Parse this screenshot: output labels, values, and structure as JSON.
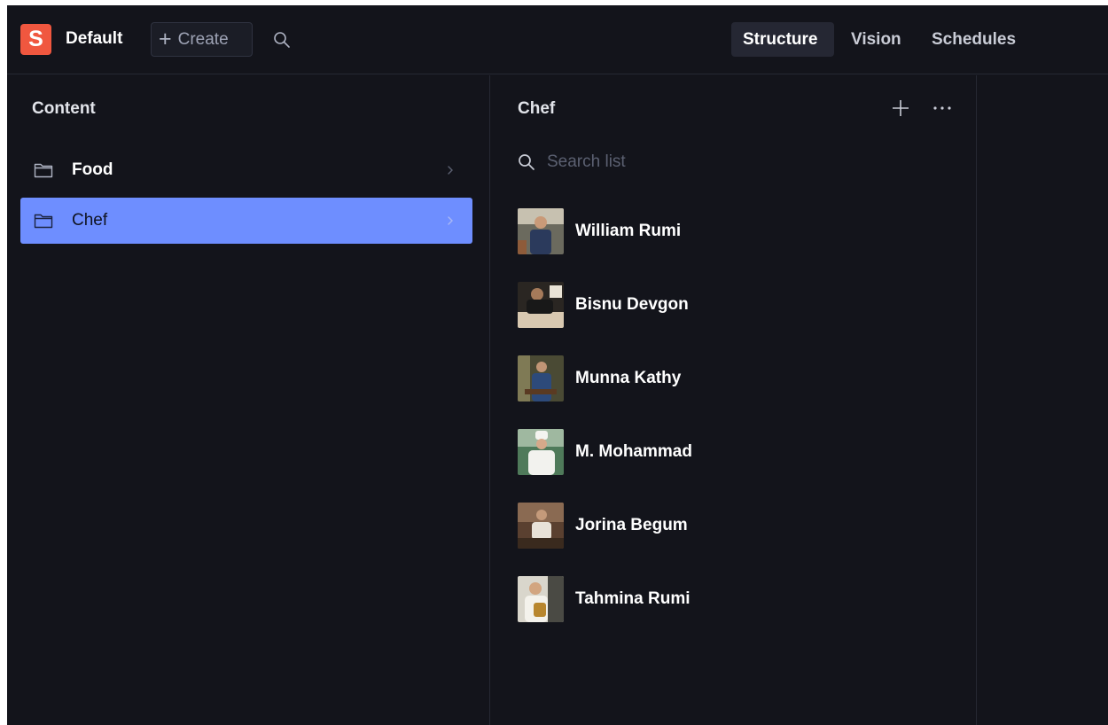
{
  "header": {
    "logo_letter": "S",
    "workspace": "Default",
    "create_label": "Create",
    "tools": [
      {
        "label": "Structure",
        "active": true
      },
      {
        "label": "Vision",
        "active": false
      },
      {
        "label": "Schedules",
        "active": false
      }
    ],
    "icons": {
      "create": "plus-icon",
      "search": "search-icon"
    }
  },
  "content_pane": {
    "title": "Content",
    "items": [
      {
        "label": "Food",
        "selected": false,
        "icon": "folder-icon"
      },
      {
        "label": "Chef",
        "selected": true,
        "icon": "folder-icon"
      }
    ]
  },
  "list_pane": {
    "title": "Chef",
    "search_placeholder": "Search list",
    "items": [
      {
        "name": "William Rumi"
      },
      {
        "name": "Bisnu Devgon"
      },
      {
        "name": "Munna Kathy"
      },
      {
        "name": "M. Mohammad"
      },
      {
        "name": "Jorina Begum"
      },
      {
        "name": "Tahmina Rumi"
      }
    ],
    "icons": {
      "add": "plus-icon",
      "more": "more-horizontal-icon",
      "search": "search-icon"
    }
  },
  "colors": {
    "background": "#13141b",
    "accent_selected": "#6e8eff",
    "brand": "#f0573f",
    "active_tab_bg": "#252733"
  }
}
